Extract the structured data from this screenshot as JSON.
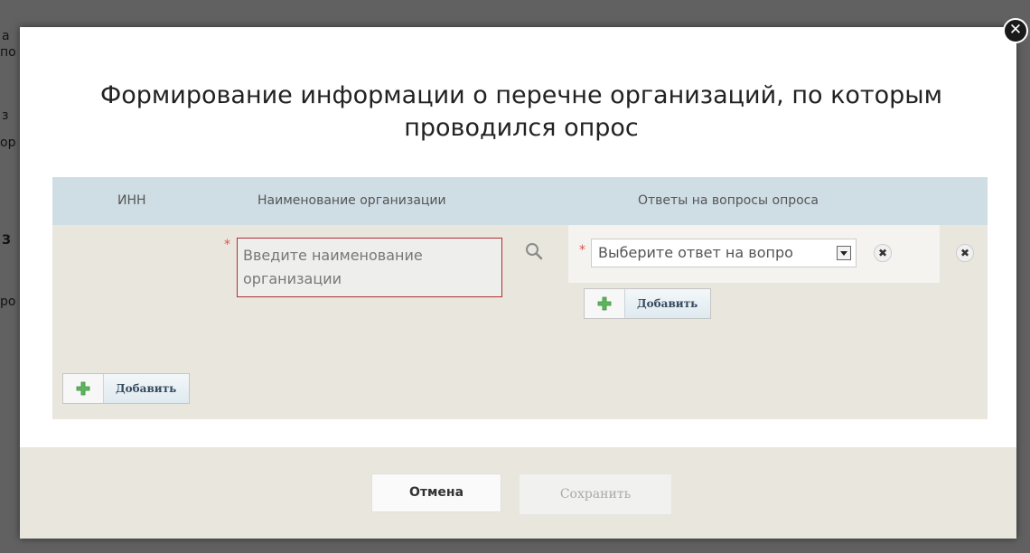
{
  "background": {
    "fragments": [
      "а",
      "по",
      "з",
      "ор",
      "З",
      "ро"
    ]
  },
  "dialog": {
    "title": "Формирование информации о перечне организаций, по которым проводился опрос",
    "close_icon": "close-icon",
    "table": {
      "headers": {
        "inn": "ИНН",
        "name": "Наименование организации",
        "answers": "Ответы на вопросы опроса"
      },
      "row": {
        "inn_value": "",
        "required_mark": "*",
        "name_placeholder": "Введите наименование организации",
        "answer_select_value": "Выберите ответ на вопро",
        "answer_add_label": "Добавить"
      },
      "add_row_label": "Добавить"
    },
    "footer": {
      "cancel_label": "Отмена",
      "save_label": "Сохранить"
    },
    "colors": {
      "header_bg": "#cfdee5",
      "row_bg": "#e8e6dd",
      "required": "#d9534f",
      "plus_icon": "#5cb85c"
    }
  }
}
